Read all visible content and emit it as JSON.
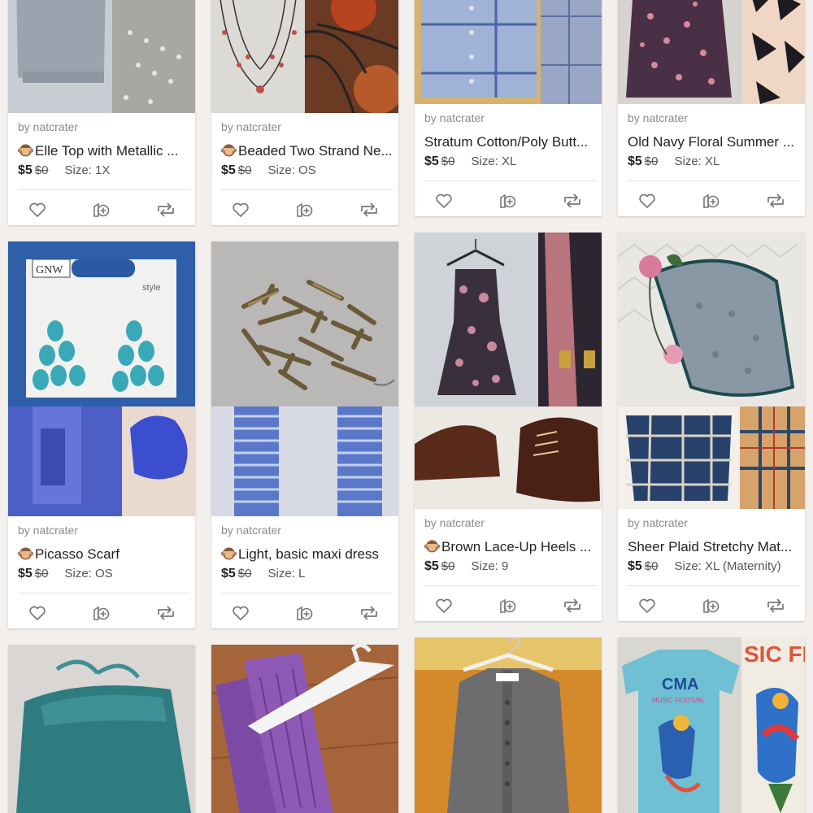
{
  "listings": [
    {
      "seller": "by natcrater",
      "title": "Elle Top with Metallic ...",
      "price": "$5",
      "original": "$0",
      "size": "Size: 1X",
      "monkey": true
    },
    {
      "seller": "by natcrater",
      "title": "Beaded Two Strand Ne...",
      "price": "$5",
      "original": "$0",
      "size": "Size: OS",
      "monkey": true
    },
    {
      "seller": "by natcrater",
      "title": "Stratum Cotton/Poly Butt...",
      "price": "$5",
      "original": "$0",
      "size": "Size: XL",
      "monkey": false
    },
    {
      "seller": "by natcrater",
      "title": "Old Navy Floral Summer ...",
      "price": "$5",
      "original": "$0",
      "size": "Size: XL",
      "monkey": false
    },
    {
      "seller": "by natcrater",
      "title": "Picasso Scarf",
      "price": "$5",
      "original": "$0",
      "size": "Size: OS",
      "monkey": true
    },
    {
      "seller": "by natcrater",
      "title": "Light, basic maxi dress",
      "price": "$5",
      "original": "$0",
      "size": "Size: L",
      "monkey": true
    },
    {
      "seller": "by natcrater",
      "title": "Brown Lace-Up Heels ...",
      "price": "$5",
      "original": "$0",
      "size": "Size: 9",
      "monkey": true
    },
    {
      "seller": "by natcrater",
      "title": "Sheer Plaid Stretchy Mat...",
      "price": "$5",
      "original": "$0",
      "size": "Size: XL (Maternity)",
      "monkey": false
    }
  ],
  "photo_text": {
    "gnw_brand": "GNW",
    "style_tag": "style",
    "cma": "CMA",
    "music_festival": "MUSIC FESTIVAL",
    "sic_fes": "SIC FES"
  },
  "icons": {
    "like": "heart-icon",
    "add_to_bundle": "add-to-bundle-icon",
    "share": "share-icon",
    "see_no_evil_monkey": "monkey-emoji-icon"
  },
  "colors": {
    "background": "#f2efed",
    "card": "#ffffff",
    "text": "#222222",
    "muted": "#8b8b8b"
  }
}
